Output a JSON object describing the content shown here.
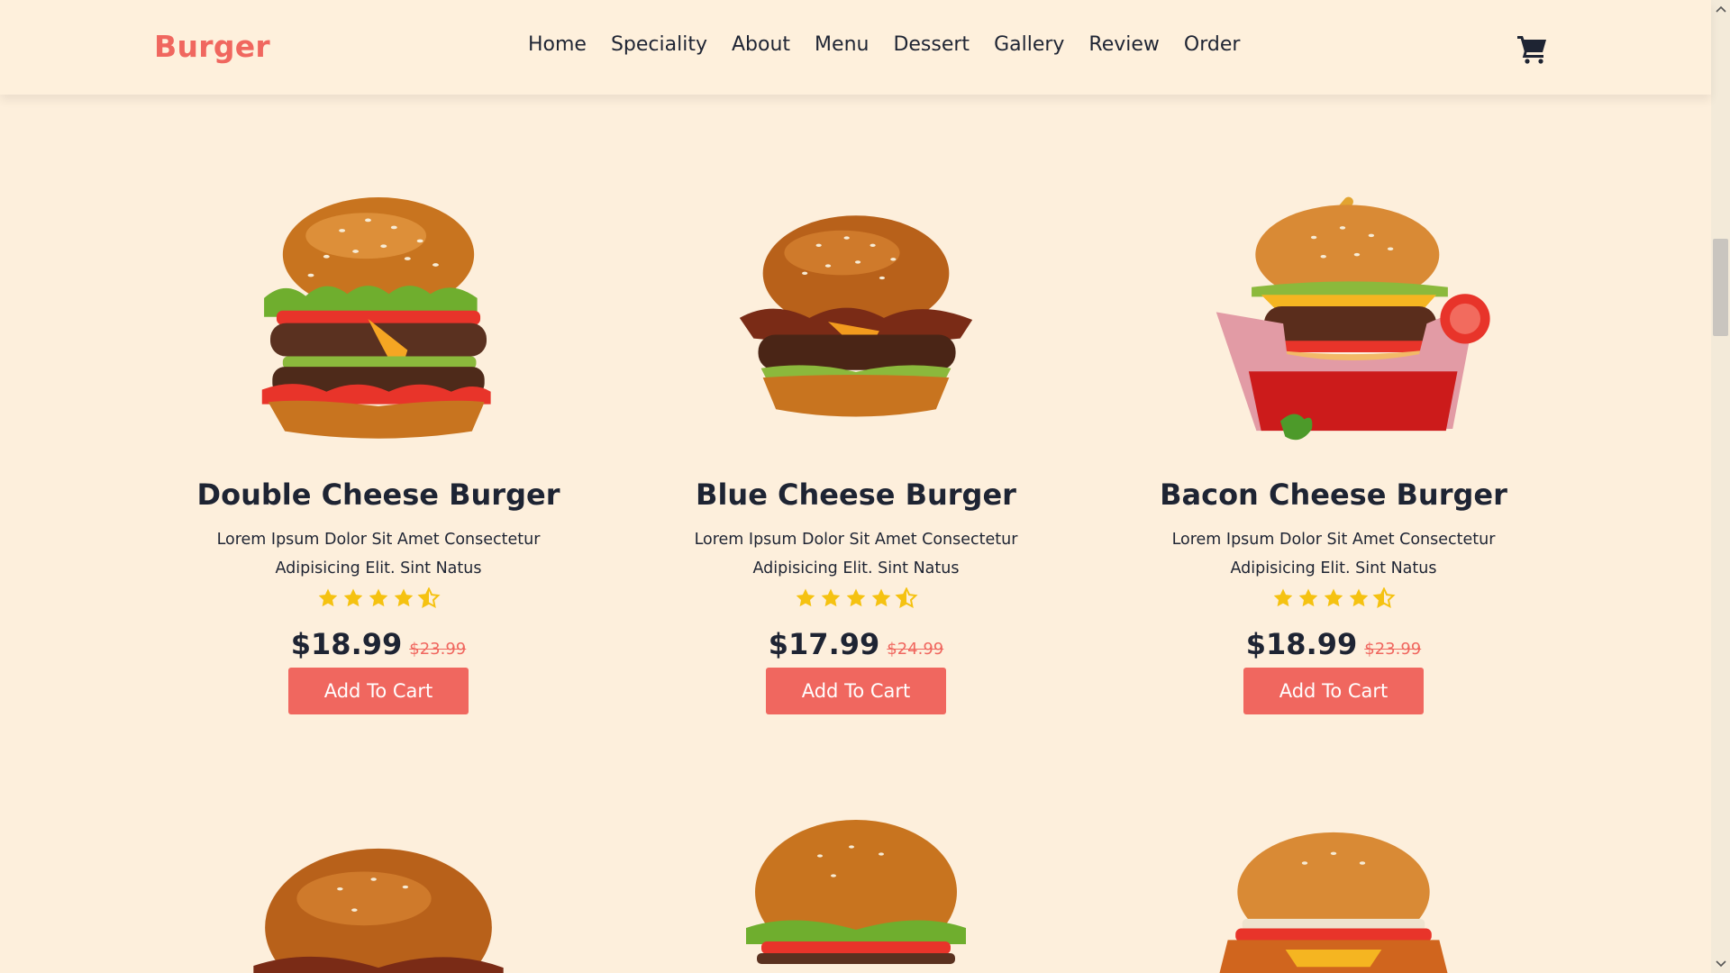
{
  "brand": "Burger",
  "nav": [
    "Home",
    "Speciality",
    "About",
    "Menu",
    "Dessert",
    "Gallery",
    "Review",
    "Order"
  ],
  "colors": {
    "accent": "#f0675f",
    "background": "#fdefdc",
    "text": "#1e2433",
    "star": "#f5c211"
  },
  "icons": {
    "cart": "cart-icon",
    "rating": "star-icon"
  },
  "products": [
    {
      "name": "Double Cheese Burger",
      "desc": "Lorem Ipsum Dolor Sit Amet Consectetur Adipisicing Elit. Sint Natus",
      "price": "$18.99",
      "old_price": "$23.99",
      "rating": 4.5,
      "cta": "Add To Cart"
    },
    {
      "name": "Blue Cheese Burger",
      "desc": "Lorem Ipsum Dolor Sit Amet Consectetur Adipisicing Elit. Sint Natus",
      "price": "$17.99",
      "old_price": "$24.99",
      "rating": 4.5,
      "cta": "Add To Cart"
    },
    {
      "name": "Bacon Cheese Burger",
      "desc": "Lorem Ipsum Dolor Sit Amet Consectetur Adipisicing Elit. Sint Natus",
      "price": "$18.99",
      "old_price": "$23.99",
      "rating": 4.5,
      "cta": "Add To Cart"
    }
  ]
}
